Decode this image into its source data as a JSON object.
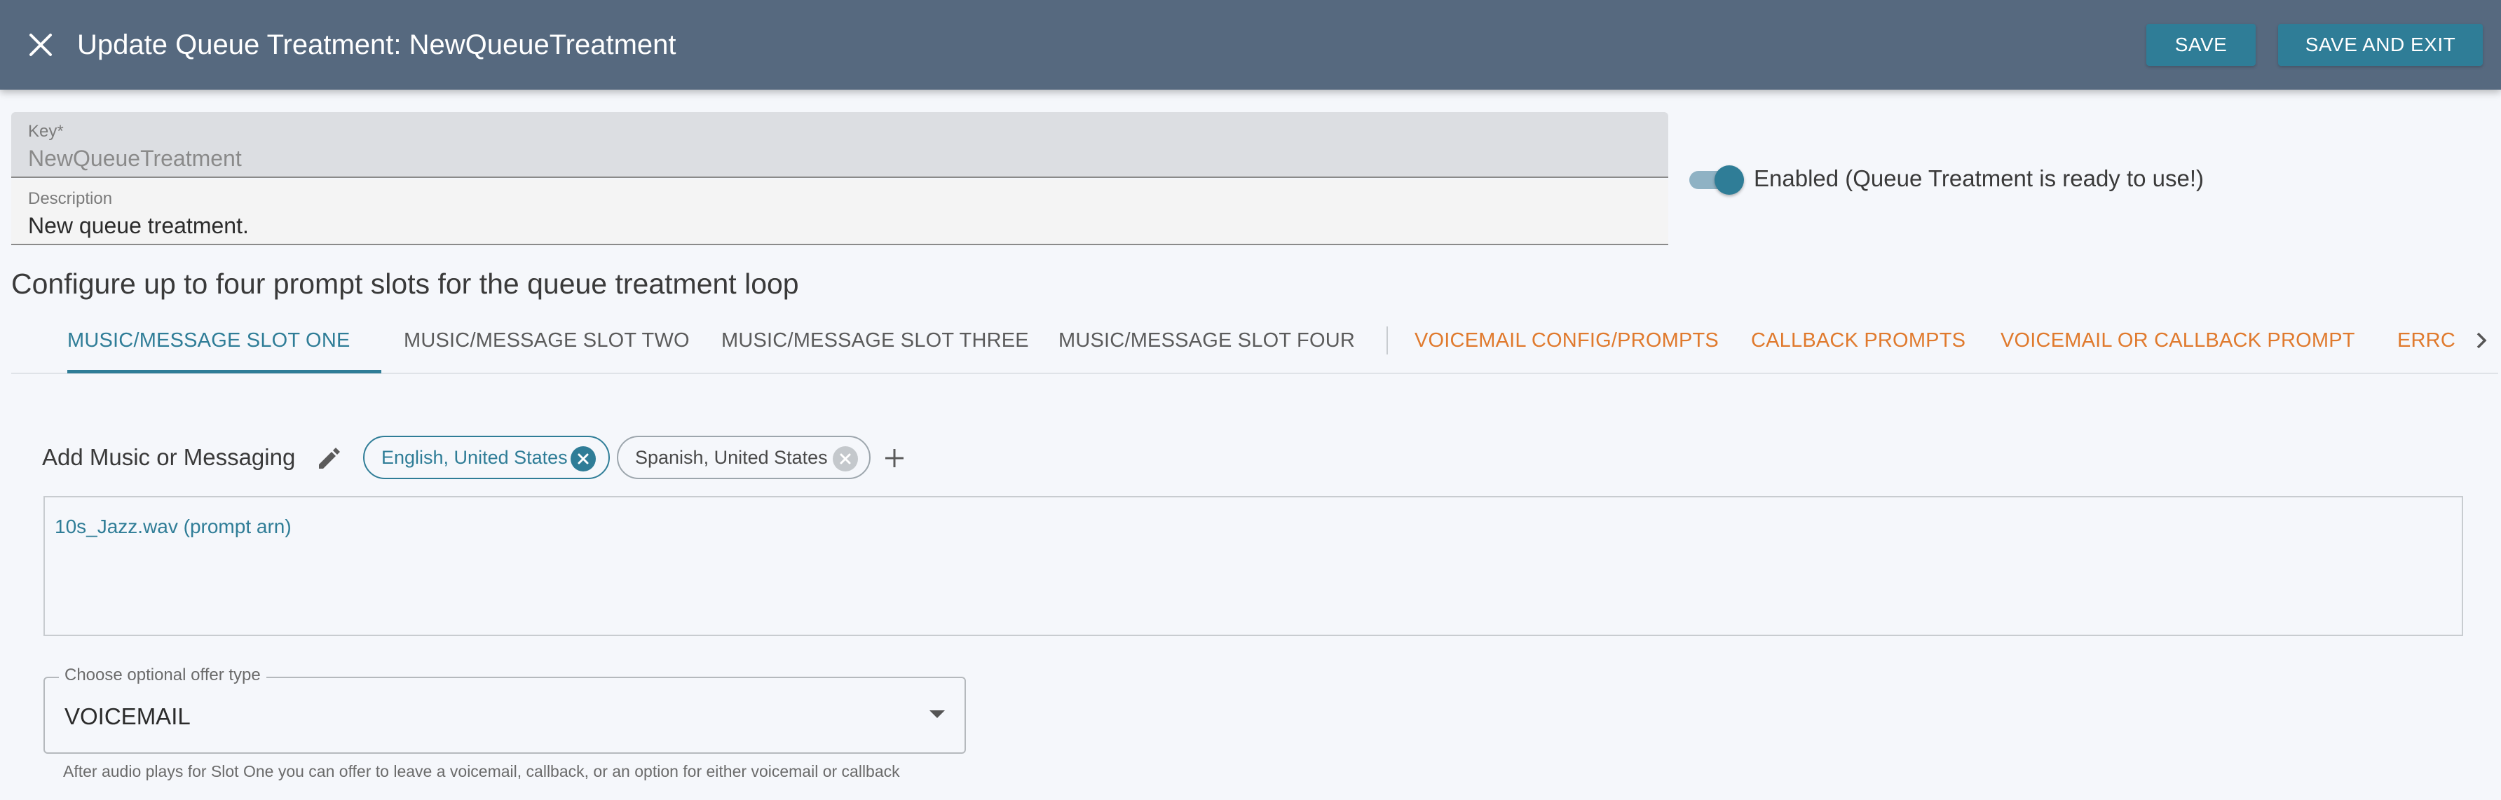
{
  "header": {
    "title": "Update Queue Treatment: NewQueueTreatment",
    "save_label": "SAVE",
    "save_exit_label": "SAVE AND EXIT",
    "close_icon": "close-icon",
    "background": "#56697f",
    "button_color": "#2f7d97"
  },
  "form": {
    "key_label": "Key*",
    "key_value": "NewQueueTreatment",
    "description_label": "Description",
    "description_value": "New queue treatment."
  },
  "enabled": {
    "on": true,
    "label": "Enabled (Queue Treatment is ready to use!)"
  },
  "section": {
    "heading": "Configure up to four prompt slots for the queue treatment loop"
  },
  "tabs": [
    {
      "label": "MUSIC/MESSAGE SLOT ONE",
      "active": true
    },
    {
      "label": "MUSIC/MESSAGE SLOT TWO"
    },
    {
      "label": "MUSIC/MESSAGE SLOT THREE"
    },
    {
      "label": "MUSIC/MESSAGE SLOT FOUR"
    },
    {
      "label": "VOICEMAIL CONFIG/PROMPTS"
    },
    {
      "label": "CALLBACK PROMPTS"
    },
    {
      "label": "VOICEMAIL OR CALLBACK PROMPT"
    },
    {
      "label": "ERRC"
    }
  ],
  "music": {
    "label": "Add Music or Messaging",
    "languages": [
      {
        "label": "English, United States",
        "selected": true
      },
      {
        "label": "Spanish, United States",
        "selected": false
      }
    ],
    "prompt_link": "10s_Jazz.wav (prompt arn)"
  },
  "offer": {
    "legend": "Choose optional offer type",
    "value": "VOICEMAIL",
    "helper": "After audio plays for Slot One you can offer to leave a voicemail, callback, or an option for either voicemail or callback"
  },
  "colors": {
    "accent": "#2f7d97",
    "orange_tab": "#e07a2d"
  }
}
